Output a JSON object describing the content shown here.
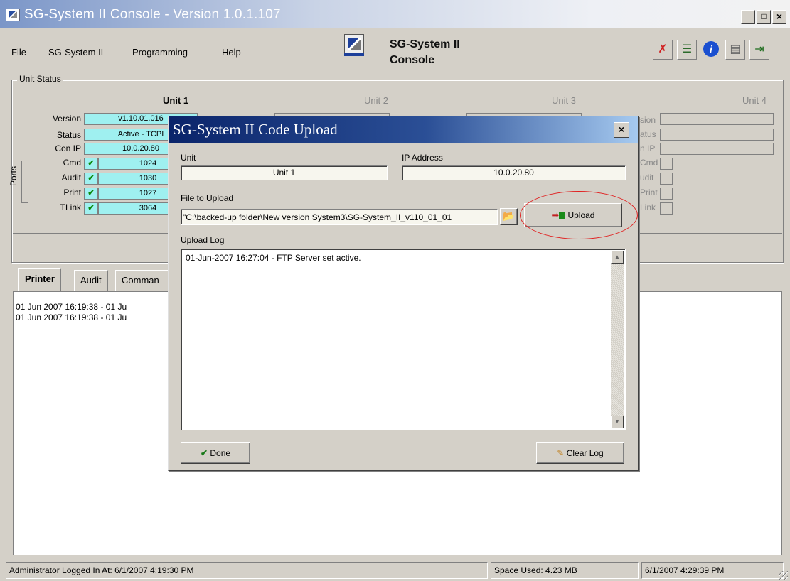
{
  "window": {
    "title": "SG-System II Console - Version 1.0.1.107",
    "controls": [
      "_",
      "□",
      "×"
    ]
  },
  "menu": {
    "items": [
      "File",
      "SG-System II",
      "Programming",
      "Help"
    ]
  },
  "header": {
    "title_line1": "SG-System II",
    "title_line2": "Console"
  },
  "toolbar": {
    "icons": [
      "disconnect-icon",
      "network-icon",
      "info-icon",
      "log-icon",
      "exit-icon"
    ]
  },
  "unit_status": {
    "legend": "Unit Status",
    "units": [
      "Unit 1",
      "Unit 2",
      "Unit 3",
      "Unit 4"
    ],
    "row_labels": [
      "Version",
      "Status",
      "Con IP"
    ],
    "port_labels": [
      "Cmd",
      "Audit",
      "Print",
      "TLink"
    ],
    "ports_group_label": "Ports",
    "unit1": {
      "version": "v1.10.01.016",
      "status": "Active - TCPI",
      "con_ip": "10.0.20.80",
      "ports": [
        "1024",
        "1030",
        "1027",
        "3064"
      ]
    },
    "unit4_row_labels": [
      "sion",
      "atus",
      "n IP",
      "Cmd",
      "udit",
      "Print",
      "Link"
    ]
  },
  "tabs": {
    "items": [
      "Printer",
      "Audit",
      "Comman"
    ],
    "active": "Printer"
  },
  "printer_log": [
    "01 Jun 2007 16:19:38 - 01 Ju",
    "01 Jun 2007 16:19:38 - 01 Ju"
  ],
  "status_bar": {
    "login": "Administrator Logged In At: 6/1/2007 4:19:30 PM",
    "space": "Space Used: 4.23 MB",
    "datetime": "6/1/2007 4:29:39 PM"
  },
  "dialog": {
    "title": "SG-System II Code Upload",
    "close": "×",
    "unit_label": "Unit",
    "unit_value": "Unit 1",
    "ip_label": "IP Address",
    "ip_value": "10.0.20.80",
    "file_label": "File to Upload",
    "file_value": "\"C:\\backed-up folder\\New version System3\\SG-System_II_v110_01_01",
    "upload_button": "Upload",
    "log_label": "Upload Log",
    "log_lines": [
      "01-Jun-2007 16:27:04 - FTP Server set active."
    ],
    "done_button": "Done",
    "clear_button": "Clear Log"
  }
}
